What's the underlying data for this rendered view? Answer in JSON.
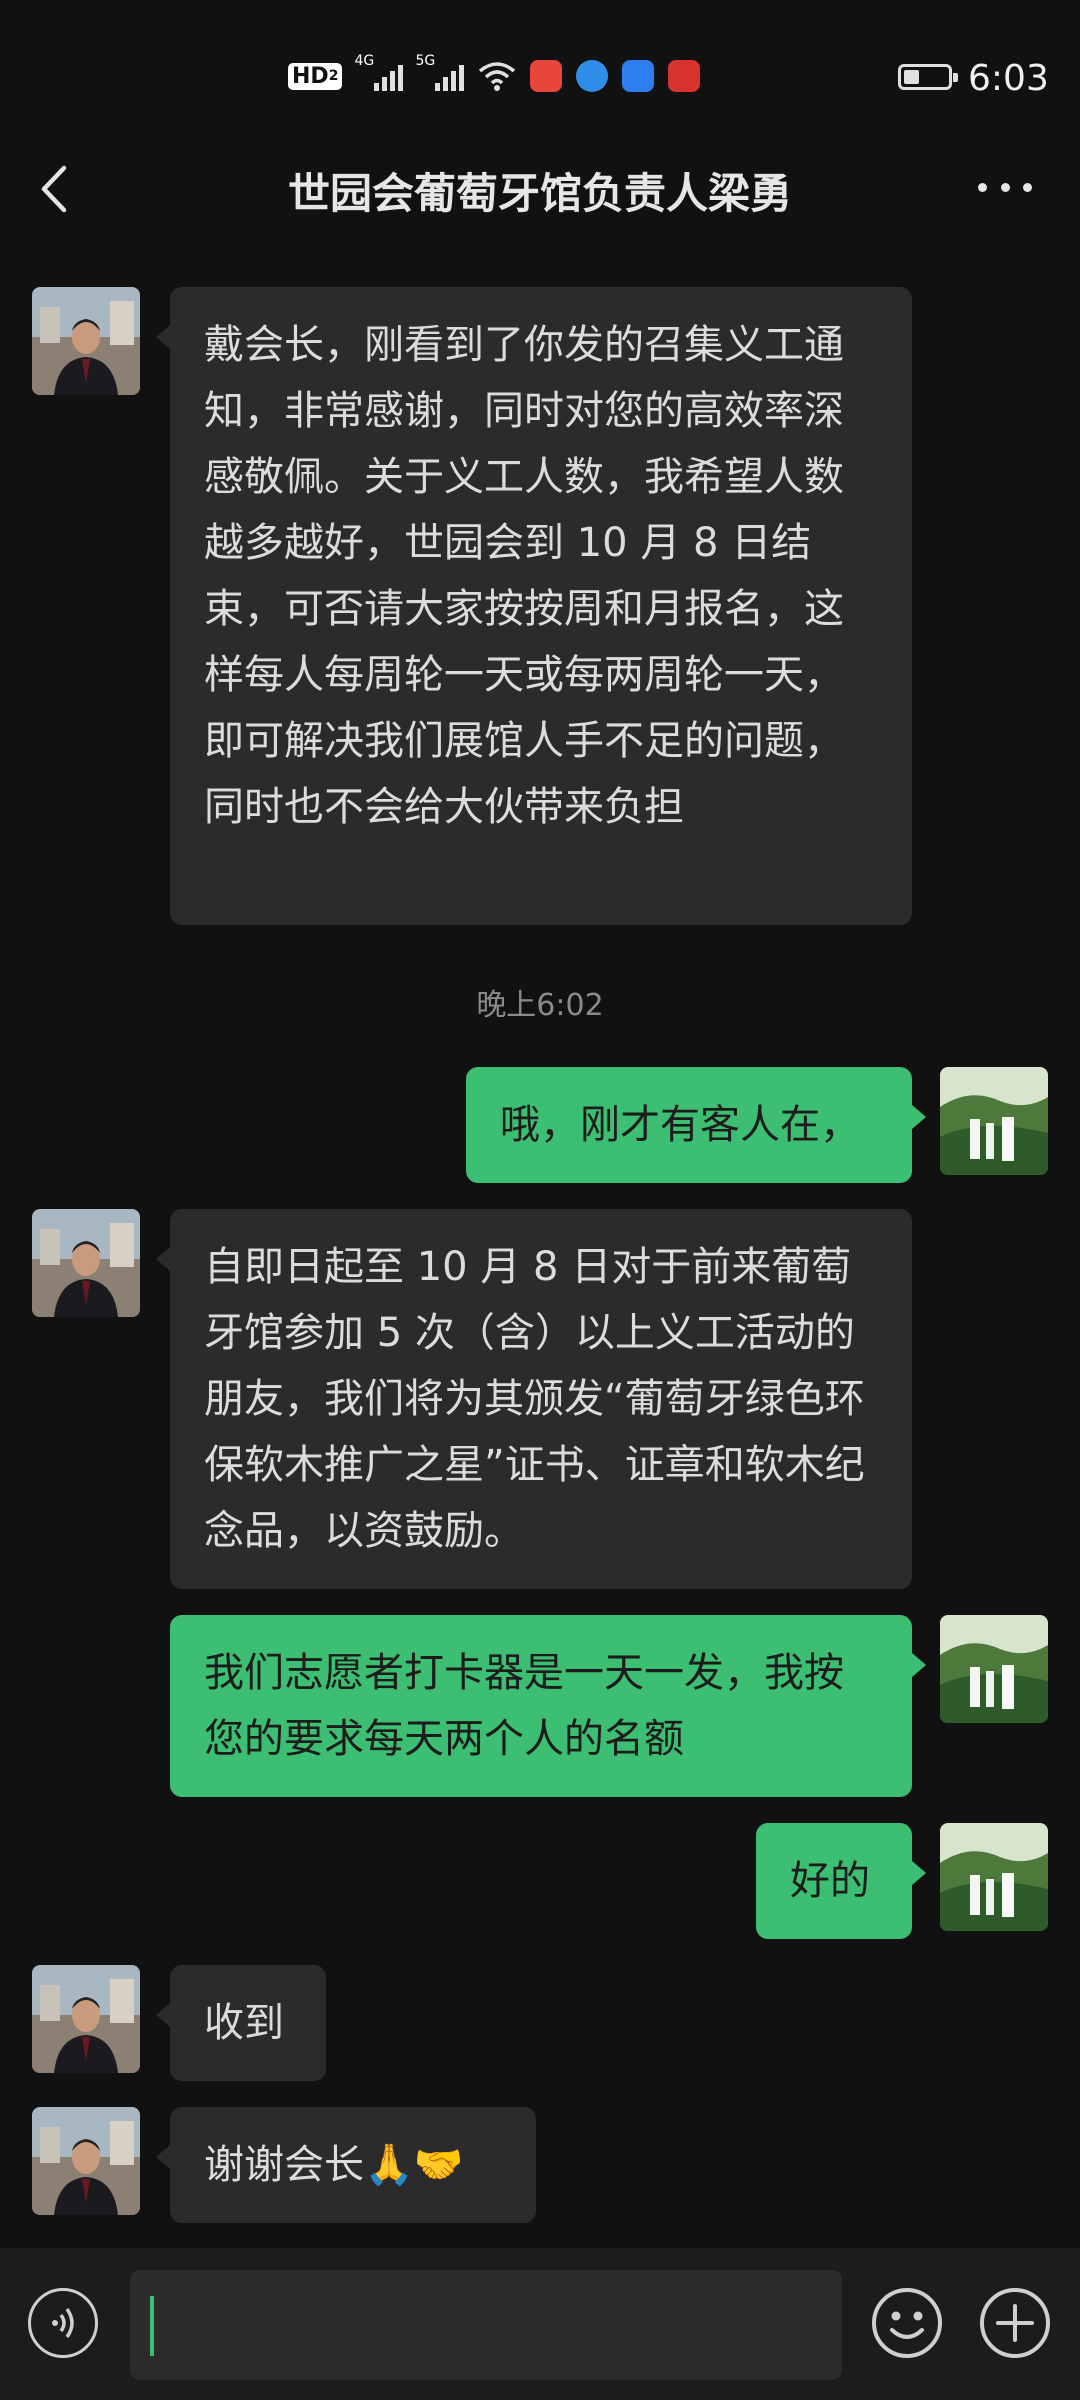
{
  "status_bar": {
    "hd_label": "HD",
    "hd_sub": "2",
    "network_1": "4G",
    "network_2": "5G",
    "time": "6:03",
    "battery_level": 0.35,
    "app_icon_colors": [
      "#e8463a",
      "#2f8fe8",
      "#2d7ff0",
      "#d8322e"
    ]
  },
  "header": {
    "title": "世园会葡萄牙馆负责人梁勇",
    "back_icon": "chevron-left-icon",
    "more_icon": "more-dots-icon"
  },
  "messages": [
    {
      "side": "left",
      "text": "戴会长，刚看到了你发的召集义工通知，非常感谢，同时对您的高效率深感敬佩。关于义工人数，我希望人数越多越好，世园会到 10 月 8 日结束，可否请大家按按周和月报名，这样每人每周轮一天或每两周轮一天，即可解决我们展馆人手不足的问题，同时也不会给大伙带来负担"
    },
    {
      "type": "timestamp",
      "text": "晚上6:02"
    },
    {
      "side": "right",
      "text": "哦，刚才有客人在，"
    },
    {
      "side": "left",
      "text": "自即日起至 10 月 8 日对于前来葡萄牙馆参加 5 次（含）以上义工活动的朋友，我们将为其颁发“葡萄牙绿色环保软木推广之星”证书、证章和软木纪念品，以资鼓励。"
    },
    {
      "side": "right",
      "text": "我们志愿者打卡器是一天一发，我按您的要求每天两个人的名额"
    },
    {
      "side": "right",
      "text": "好的"
    },
    {
      "side": "left",
      "text": "收到"
    },
    {
      "side": "left",
      "text": "谢谢会长🙏🤝"
    }
  ],
  "input_bar": {
    "voice_icon": "voice-icon",
    "input_value": "",
    "emoji_icon": "emoji-icon",
    "plus_icon": "plus-icon"
  },
  "colors": {
    "background": "#111111",
    "bubble_left": "#2b2b2b",
    "bubble_right": "#3dbf73",
    "accent": "#3dbf73"
  }
}
